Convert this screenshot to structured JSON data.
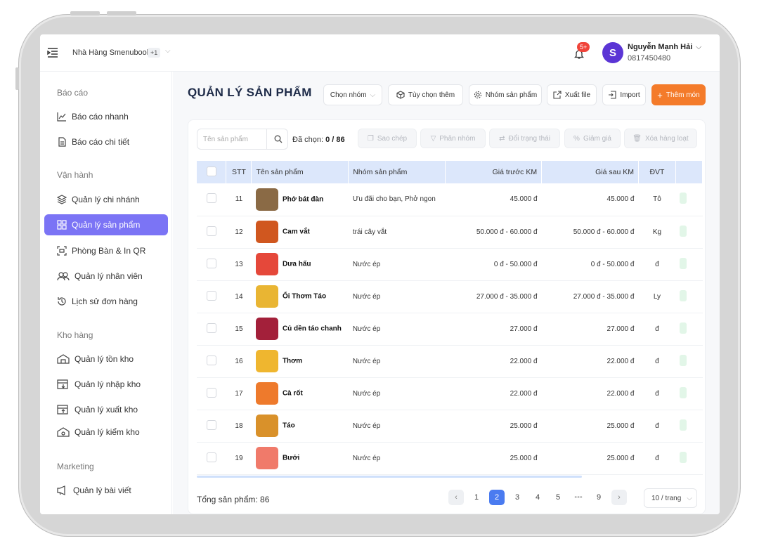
{
  "topbar": {
    "store_name": "Nhà Hàng Smenubook",
    "store_extra": "+1",
    "notif_count": "5+",
    "user_name": "Nguyễn Mạnh Hải",
    "user_phone": "0817450480",
    "avatar_letter": "S"
  },
  "sidebar": {
    "sections": {
      "reports": "Báo cáo",
      "operations": "Vận hành",
      "warehouse": "Kho hàng",
      "marketing": "Marketing"
    },
    "items": [
      {
        "label": "Báo cáo nhanh",
        "icon": "chart-line-icon"
      },
      {
        "label": "Báo cáo chi tiết",
        "icon": "document-icon"
      },
      {
        "label": "Quản lý chi nhánh",
        "icon": "layers-icon"
      },
      {
        "label": "Quản lý sản phẩm",
        "icon": "grid-icon"
      },
      {
        "label": "Phòng Bàn & In QR",
        "icon": "qr-scan-icon"
      },
      {
        "label": "Quản lý nhân viên",
        "icon": "users-icon"
      },
      {
        "label": "Lịch sử đơn hàng",
        "icon": "history-icon"
      },
      {
        "label": "Quản lý tồn kho",
        "icon": "warehouse-icon"
      },
      {
        "label": "Quản lý nhập kho",
        "icon": "import-box-icon"
      },
      {
        "label": "Quản lý xuất kho",
        "icon": "export-box-icon"
      },
      {
        "label": "Quản lý kiểm kho",
        "icon": "inspect-box-icon"
      },
      {
        "label": "Quản lý bài viết",
        "icon": "megaphone-icon"
      }
    ]
  },
  "page": {
    "title": "QUẢN LÝ SẢN PHẨM",
    "toolbar": {
      "group_select": "Chọn nhóm",
      "more_options": "Tùy chọn thêm",
      "product_groups": "Nhóm sản phẩm",
      "export": "Xuất file",
      "import": "Import",
      "add": "Thêm món"
    },
    "search_placeholder": "Tên sản phẩm",
    "selected_label": "Đã chọn:",
    "selected_value": "0 / 86",
    "actions": {
      "copy": "Sao chép",
      "group": "Phân nhóm",
      "status": "Đổi trạng thái",
      "discount": "Giảm giá",
      "bulk_delete": "Xóa hàng loạt"
    }
  },
  "table": {
    "headers": {
      "stt": "STT",
      "name": "Tên sản phẩm",
      "group": "Nhóm sản phẩm",
      "price_before": "Giá trước KM",
      "price_after": "Giá sau KM",
      "unit": "ĐVT"
    },
    "rows": [
      {
        "stt": "11",
        "name": "Phở bát đàn",
        "group": "Ưu đãi cho bạn, Phở ngon",
        "before": "45.000 đ",
        "after": "45.000 đ",
        "unit": "Tô",
        "color": "#8a6a45"
      },
      {
        "stt": "12",
        "name": "Cam vắt",
        "group": "trái cây vắt",
        "before": "50.000 đ - 60.000 đ",
        "after": "50.000 đ - 60.000 đ",
        "unit": "Kg",
        "color": "#d0571f"
      },
      {
        "stt": "13",
        "name": "Dưa hấu",
        "group": "Nước ép",
        "before": "0 đ - 50.000 đ",
        "after": "0 đ - 50.000 đ",
        "unit": "đ",
        "color": "#e5483a"
      },
      {
        "stt": "14",
        "name": "Ổi Thơm Táo",
        "group": "Nước ép",
        "before": "27.000 đ - 35.000 đ",
        "after": "27.000 đ - 35.000 đ",
        "unit": "Ly",
        "color": "#e9b533"
      },
      {
        "stt": "15",
        "name": "Củ dền táo chanh",
        "group": "Nước ép",
        "before": "27.000 đ",
        "after": "27.000 đ",
        "unit": "đ",
        "color": "#a3203a"
      },
      {
        "stt": "16",
        "name": "Thơm",
        "group": "Nước ép",
        "before": "22.000 đ",
        "after": "22.000 đ",
        "unit": "đ",
        "color": "#efb62f"
      },
      {
        "stt": "17",
        "name": "Cà rốt",
        "group": "Nước ép",
        "before": "22.000 đ",
        "after": "22.000 đ",
        "unit": "đ",
        "color": "#ee7a2c"
      },
      {
        "stt": "18",
        "name": "Táo",
        "group": "Nước ép",
        "before": "25.000 đ",
        "after": "25.000 đ",
        "unit": "đ",
        "color": "#d9912a"
      },
      {
        "stt": "19",
        "name": "Bưởi",
        "group": "Nước ép",
        "before": "25.000 đ",
        "after": "25.000 đ",
        "unit": "đ",
        "color": "#f07a6a"
      }
    ]
  },
  "footer": {
    "total": "Tổng sản phẩm: 86",
    "pages": [
      "1",
      "2",
      "3",
      "4",
      "5",
      "•••",
      "9"
    ],
    "current_page": "2",
    "page_size": "10 / trang"
  }
}
